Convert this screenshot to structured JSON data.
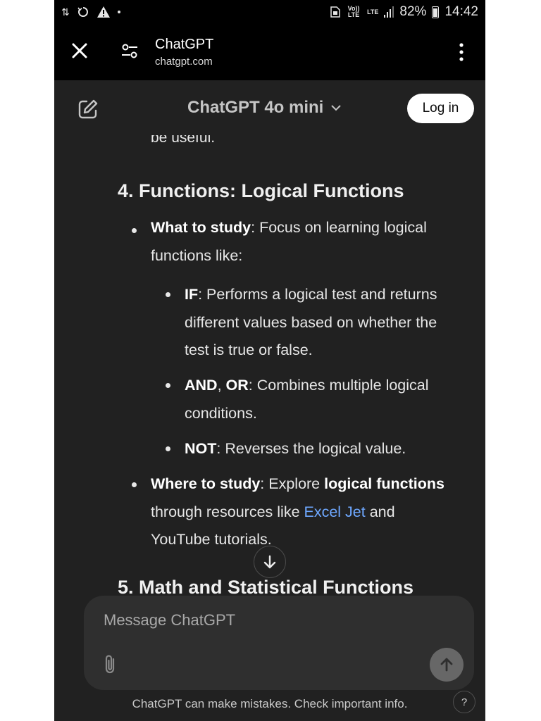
{
  "status_bar": {
    "battery_percent": "82%",
    "time": "14:42",
    "network_1": "Vo)) LTE",
    "network_2": "LTE",
    "icons_left": [
      "data-transfer-icon",
      "sync-icon",
      "warning-icon",
      "dot-icon"
    ]
  },
  "browser": {
    "title": "ChatGPT",
    "url": "chatgpt.com"
  },
  "app_header": {
    "model_name": "ChatGPT 4o mini",
    "login_label": "Log in"
  },
  "content": {
    "cut_text": "be useful.",
    "section4_heading": "4. Functions: Logical Functions",
    "what_label": "What to study",
    "what_text_1": ": Focus on learning logical",
    "what_text_2": "functions like:",
    "if_label": "IF",
    "if_text_1": ": Performs a logical test and returns",
    "if_text_2": "different values based on whether the",
    "if_text_3": "test is true or false.",
    "and_label": "AND",
    "comma": ", ",
    "or_label": "OR",
    "andor_text_1": ": Combines multiple logical",
    "andor_text_2": "conditions.",
    "not_label": "NOT",
    "not_text": ": Reverses the logical value.",
    "where_label": "Where to study",
    "where_text_a": ": Explore ",
    "where_bold": "logical functions",
    "where_text_b": "through resources like ",
    "where_link": "Excel Jet",
    "where_text_c": " and",
    "where_text_d": "YouTube tutorials.",
    "section5_heading": "5. Math and Statistical Functions"
  },
  "composer": {
    "placeholder": "Message ChatGPT"
  },
  "footer": {
    "disclaimer": "ChatGPT can make mistakes. Check important info.",
    "help": "?"
  },
  "colors": {
    "background": "#212121",
    "composer_bg": "#2f2f2f",
    "link": "#6ea8ff",
    "send_button": "#676767"
  }
}
